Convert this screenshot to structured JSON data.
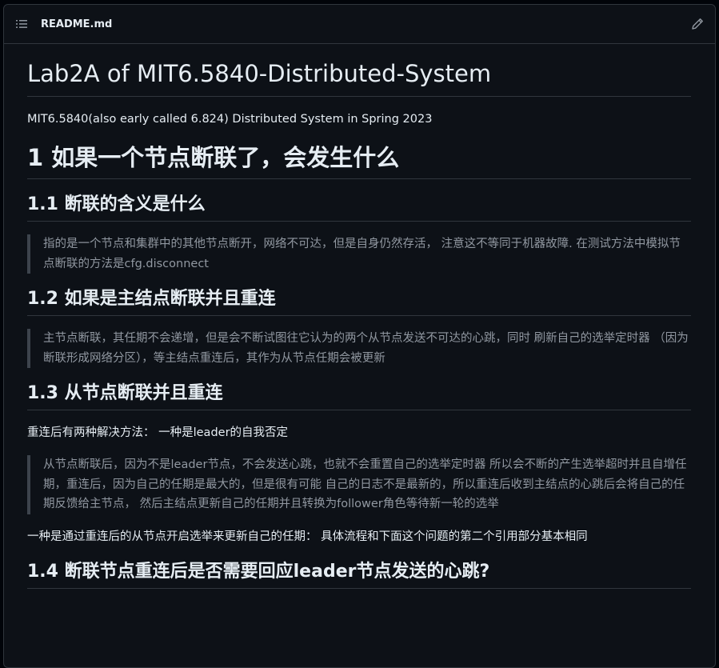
{
  "file_header": {
    "filename": "README.md",
    "toc_icon": "list-unordered-icon",
    "edit_icon": "pencil-icon"
  },
  "doc": {
    "title": "Lab2A of MIT6.5840-Distributed-System",
    "intro": "MIT6.5840(also early called 6.824) Distributed System in Spring 2023",
    "section1": {
      "heading": "1 如果一个节点断联了，会发生什么",
      "sub1": {
        "heading": "1.1 断联的含义是什么",
        "quote": "指的是一个节点和集群中的其他节点断开，网络不可达，但是自身仍然存活， 注意这不等同于机器故障. 在测试方法中模拟节点断联的方法是cfg.disconnect"
      },
      "sub2": {
        "heading": "1.2 如果是主结点断联并且重连",
        "quote": "主节点断联，其任期不会递增，但是会不断试图往它认为的两个从节点发送不可达的心跳，同时 刷新自己的选举定时器 （因为断联形成网络分区），等主结点重连后，其作为从节点任期会被更新"
      },
      "sub3": {
        "heading": "1.3 从节点断联并且重连",
        "para1": "重连后有两种解决方法： 一种是leader的自我否定",
        "quote": "从节点断联后，因为不是leader节点，不会发送心跳，也就不会重置自己的选举定时器 所以会不断的产生选举超时并且自增任期，重连后，因为自己的任期是最大的，但是很有可能 自己的日志不是最新的，所以重连后收到主结点的心跳后会将自己的任期反馈给主节点， 然后主结点更新自己的任期并且转换为follower角色等待新一轮的选举",
        "para2": "一种是通过重连后的从节点开启选举来更新自己的任期： 具体流程和下面这个问题的第二个引用部分基本相同"
      },
      "sub4": {
        "heading": "1.4 断联节点重连后是否需要回应leader节点发送的心跳?"
      }
    }
  }
}
